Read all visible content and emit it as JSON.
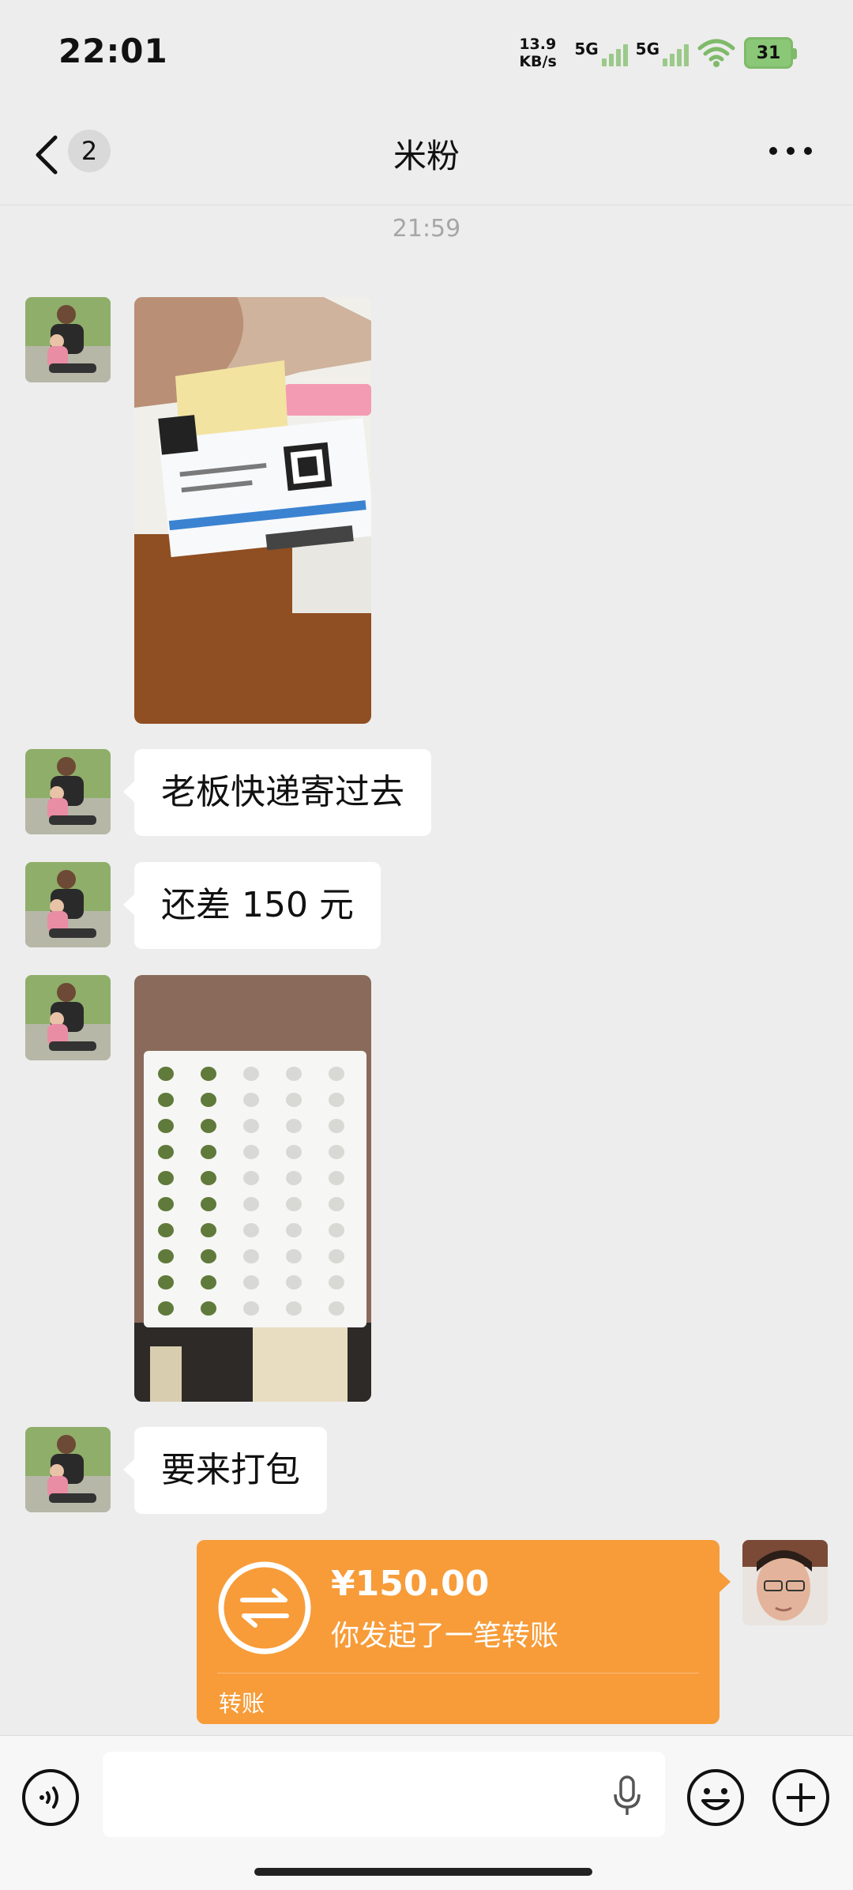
{
  "status_bar": {
    "time": "22:01",
    "net_speed_value": "13.9",
    "net_speed_unit": "KB/s",
    "net_type_1": "5G",
    "net_type_2": "5G",
    "battery": "31"
  },
  "nav": {
    "back_label": "back",
    "unread_count": "2",
    "title": "米粉",
    "more_label": "more"
  },
  "messages": {
    "timestamp": "21:59",
    "text_1": "老板快递寄过去",
    "text_2": "还差 150 元",
    "text_3": "要来打包"
  },
  "transfer": {
    "amount": "¥150.00",
    "description": "你发起了一笔转账",
    "label": "转账",
    "color": "#f79c39"
  },
  "input_bar": {
    "voice_icon": "voice-icon",
    "mic_icon": "mic-icon",
    "emoji_icon": "emoji-icon",
    "add_icon": "plus-icon"
  },
  "colors": {
    "background": "#ededed",
    "bubble": "#ffffff",
    "timestamp": "#a6a6a6"
  }
}
